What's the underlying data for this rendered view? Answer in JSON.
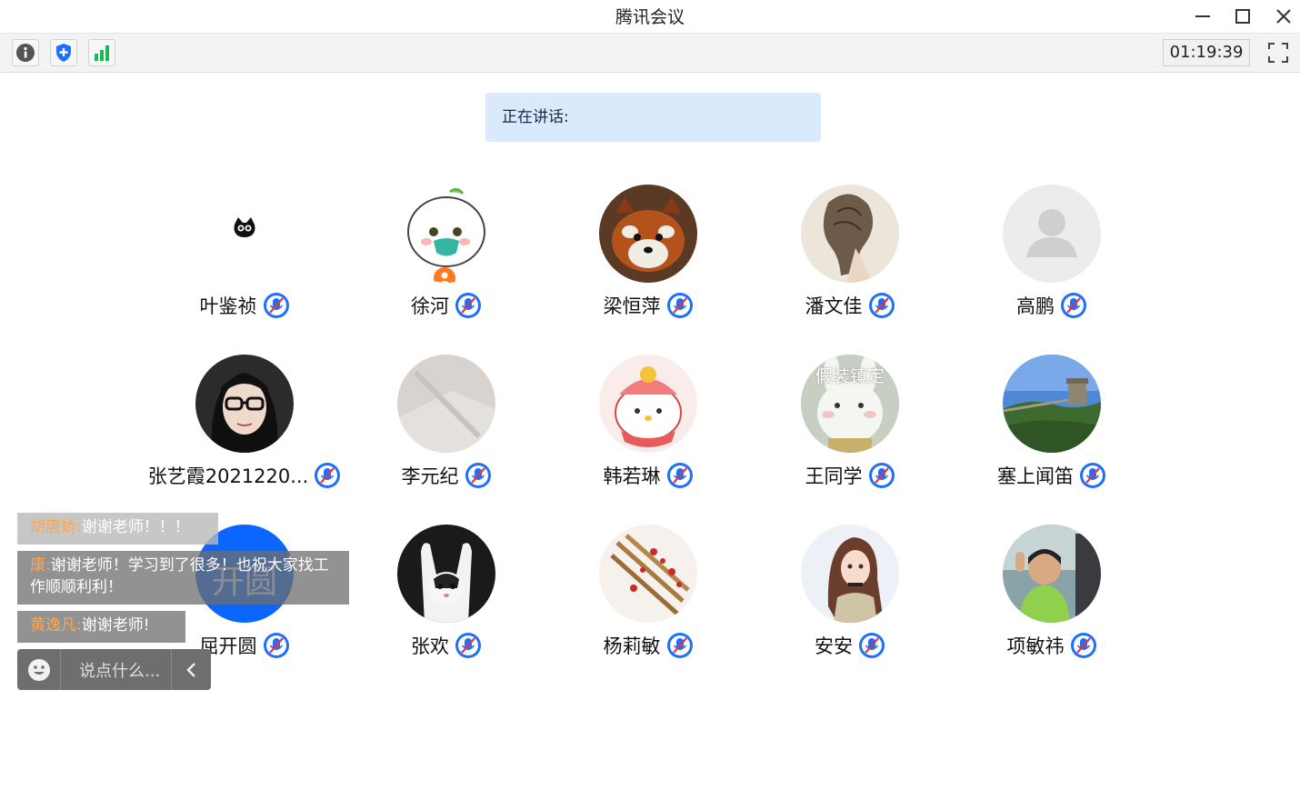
{
  "window": {
    "title": "腾讯会议"
  },
  "toolbar": {
    "timer": "01:19:39"
  },
  "speaking": {
    "label": "正在讲话:"
  },
  "participants": [
    {
      "name": "叶鉴祯"
    },
    {
      "name": "徐河"
    },
    {
      "name": "梁恒萍"
    },
    {
      "name": "潘文佳"
    },
    {
      "name": "高鹏"
    },
    {
      "name": "张艺霞2021220..."
    },
    {
      "name": "李元纪"
    },
    {
      "name": "韩若琳"
    },
    {
      "name": "王同学",
      "avatar_text": "假装镇定"
    },
    {
      "name": "塞上闻笛"
    },
    {
      "name": "屈开圆",
      "avatar_text": "开圆"
    },
    {
      "name": "张欢"
    },
    {
      "name": "杨莉敏"
    },
    {
      "name": "安安"
    },
    {
      "name": "项敏祎"
    }
  ],
  "chat": {
    "messages": [
      {
        "sender": "胡唐娇:",
        "text": "谢谢老师！！！"
      },
      {
        "sender": "康:",
        "text": "谢谢老师！学习到了很多！也祝大家找工作顺顺利利！"
      },
      {
        "sender": "黄逸凡:",
        "text": "谢谢老师!"
      }
    ],
    "input_placeholder": "说点什么..."
  },
  "colors": {
    "accent": "#1f6fff",
    "speaking_bg": "#dbe9fd",
    "sender": "#ffa64d"
  }
}
